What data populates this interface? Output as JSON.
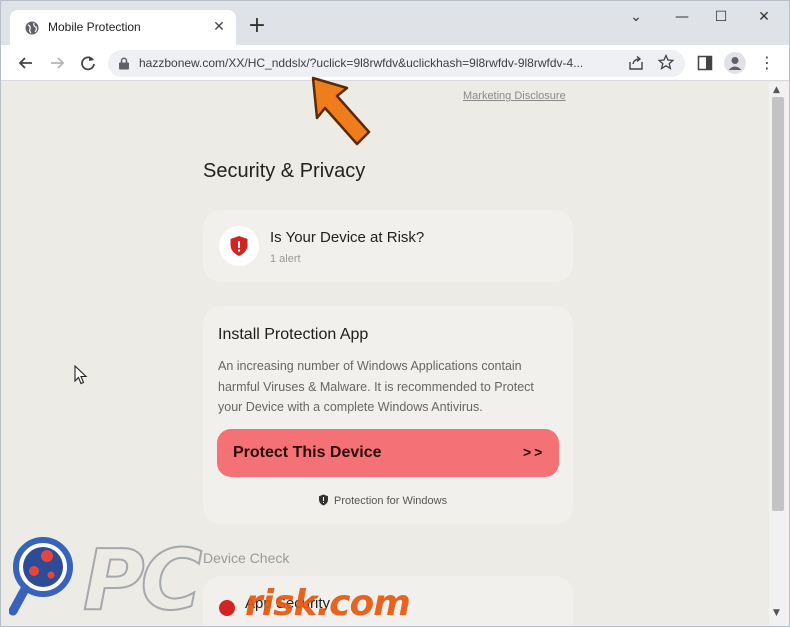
{
  "browser": {
    "tab_title": "Mobile Protection",
    "url": "hazzbonew.com/XX/HC_nddslx/?uclick=9l8rwfdv&uclickhash=9l8rwfdv-9l8rwfdv-4..."
  },
  "page": {
    "marketing_link": "Marketing Disclosure",
    "heading": "Security & Privacy",
    "risk_card": {
      "title": "Is Your Device at Risk?",
      "subtitle": "1 alert"
    },
    "install_card": {
      "title": "Install Protection App",
      "body": "An increasing number of Windows Applications contain harmful Viruses & Malware. It is recommended to Protect your Device with a complete Windows Antivirus.",
      "button_label": "Protect This Device",
      "button_arrows": ">>",
      "note": "Protection for Windows"
    },
    "device_check_label": "Device Check",
    "app_security_label": "App Security"
  },
  "watermark": {
    "brand": "PC",
    "domain_text": "risk.com"
  },
  "colors": {
    "accent_button": "#f47175",
    "shield_red": "#d32424",
    "arrow_orange": "#f07d1b"
  }
}
